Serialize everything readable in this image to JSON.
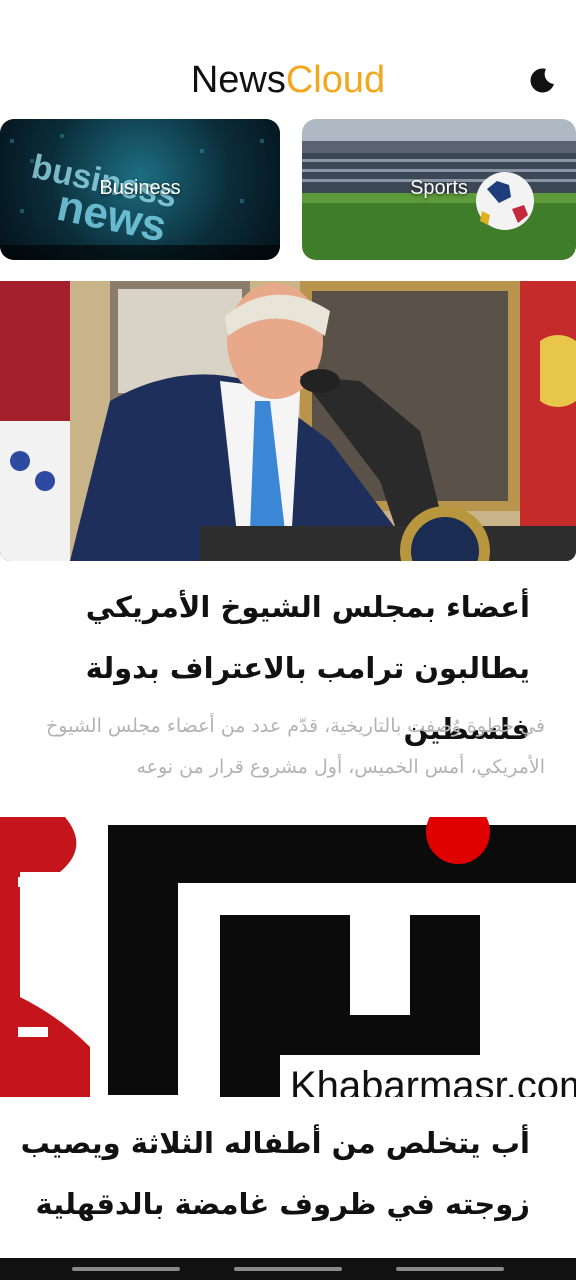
{
  "header": {
    "title_part1": "News",
    "title_part2": "Cloud",
    "accent_color": "#f2a81d",
    "theme_toggle_icon": "moon-icon"
  },
  "categories": [
    {
      "label": "Business",
      "image": "business-news-image"
    },
    {
      "label": "Sports",
      "image": "stadium-football-image"
    }
  ],
  "articles": [
    {
      "image": "president-podium-photo",
      "headline": "أعضاء بمجلس الشيوخ الأمريكي يطالبون ترامب بالاعتراف بدولة فلسطين",
      "summary": "في خطوة وُصفت بالتاريخية، قدّم عدد من أعضاء مجلس الشيوخ الأمريكي، أمس الخميس، أول مشروع قرار من نوعه"
    },
    {
      "image": "khabarmasr-logo",
      "logo_text": "Khabarmasr.com",
      "headline": "أب يتخلص من أطفاله الثلاثة ويصيب زوجته في ظروف غامضة بالدقهلية"
    }
  ]
}
